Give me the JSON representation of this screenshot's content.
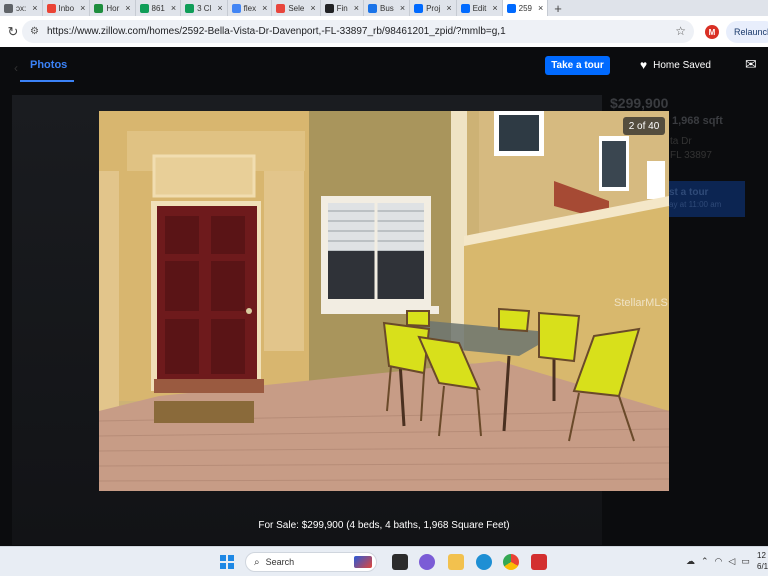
{
  "browser": {
    "tabs": [
      {
        "label": "ɔx:",
        "color": "#5f6368"
      },
      {
        "label": "Inbo",
        "color": "#ea4335"
      },
      {
        "label": "Hor",
        "color": "#1e8e3e"
      },
      {
        "label": "861",
        "color": "#0f9d58"
      },
      {
        "label": "3 Cl",
        "color": "#0f9d58"
      },
      {
        "label": "flex",
        "color": "#4285f4"
      },
      {
        "label": "Sele",
        "color": "#e8453c"
      },
      {
        "label": "Fin",
        "color": "#202124"
      },
      {
        "label": "Bus",
        "color": "#1a73e8"
      },
      {
        "label": "Proj",
        "color": "#006aff"
      },
      {
        "label": "Edit",
        "color": "#006aff"
      },
      {
        "label": "259",
        "color": "#006aff",
        "active": true
      }
    ],
    "new_tab": "+",
    "url": "https://www.zillow.com/homes/2592-Bella-Vista-Dr-Davenport,-FL-33897_rb/98461201_zpid/?mmlb=g,1",
    "avatar_letter": "M",
    "relaunch_label": "Relaunch t"
  },
  "viewer": {
    "photos_tab": "Photos",
    "take_tour": "Take a tour",
    "home_saved": "Home Saved",
    "counter": "2 of 40",
    "watermark": "StellarMLS",
    "caption": "For Sale: $299,900 (4 beds, 4 baths, 1,968 Square Feet)"
  },
  "background_listing": {
    "price": "$299,900",
    "sqft": "1,968 sqft",
    "addr1": "ta Dr",
    "addr2": "FL 33897",
    "tour": "st a tour",
    "tour_sub": "ay at 11:00 am"
  },
  "taskbar": {
    "search": "Search",
    "clock_time": "12",
    "clock_date": "6/1"
  },
  "colors": {
    "accent": "#006aff",
    "door": "#6e1a1c",
    "chair": "#d8e01b",
    "wall": "#c7a863"
  }
}
